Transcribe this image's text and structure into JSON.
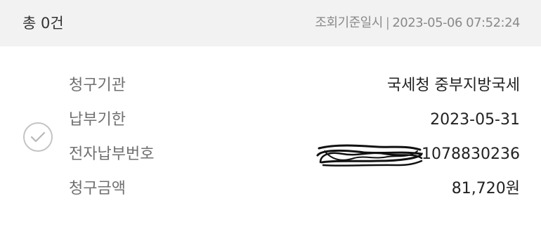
{
  "header": {
    "total_count": "총 0건",
    "query_time_label": "조회기준일시",
    "query_time_value": "2023-05-06 07:52:24"
  },
  "bill": {
    "fields": [
      {
        "label": "청구기관",
        "value": "국세청 중부지방국세"
      },
      {
        "label": "납부기한",
        "value": "2023-05-31"
      },
      {
        "label": "전자납부번호",
        "value": "1078830236"
      },
      {
        "label": "청구금액",
        "value": "81,720원"
      }
    ]
  },
  "icons": {
    "select": "check-circle-icon",
    "redaction": "scribble-redaction"
  },
  "colors": {
    "header_bg": "#f2f2f2",
    "label_text": "#707070",
    "value_text": "#222222",
    "check_border": "#c4c4c4"
  }
}
